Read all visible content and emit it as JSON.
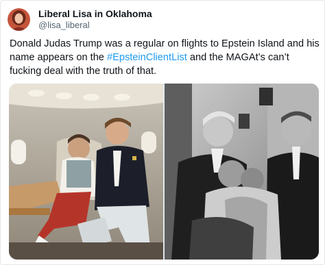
{
  "tweet": {
    "author": {
      "display_name": "Liberal Lisa in Oklahoma",
      "handle": "@lisa_liberal"
    },
    "text": {
      "part1": "Donald Judas Trump was a regular on flights to Epstein Island and his name appears on the ",
      "hashtag": "#EpsteinClientList",
      "part2": " and the MAGAt’s can’t fucking deal with the truth of that."
    },
    "media": {
      "count": 2,
      "photos": [
        {
          "name": "jet-cabin-photo",
          "tone": "color"
        },
        {
          "name": "black-and-white-photo",
          "tone": "monochrome"
        }
      ]
    }
  },
  "colors": {
    "text": "#0f1419",
    "secondary_text": "#536471",
    "link": "#1d9bf0",
    "background": "#ffffff"
  }
}
